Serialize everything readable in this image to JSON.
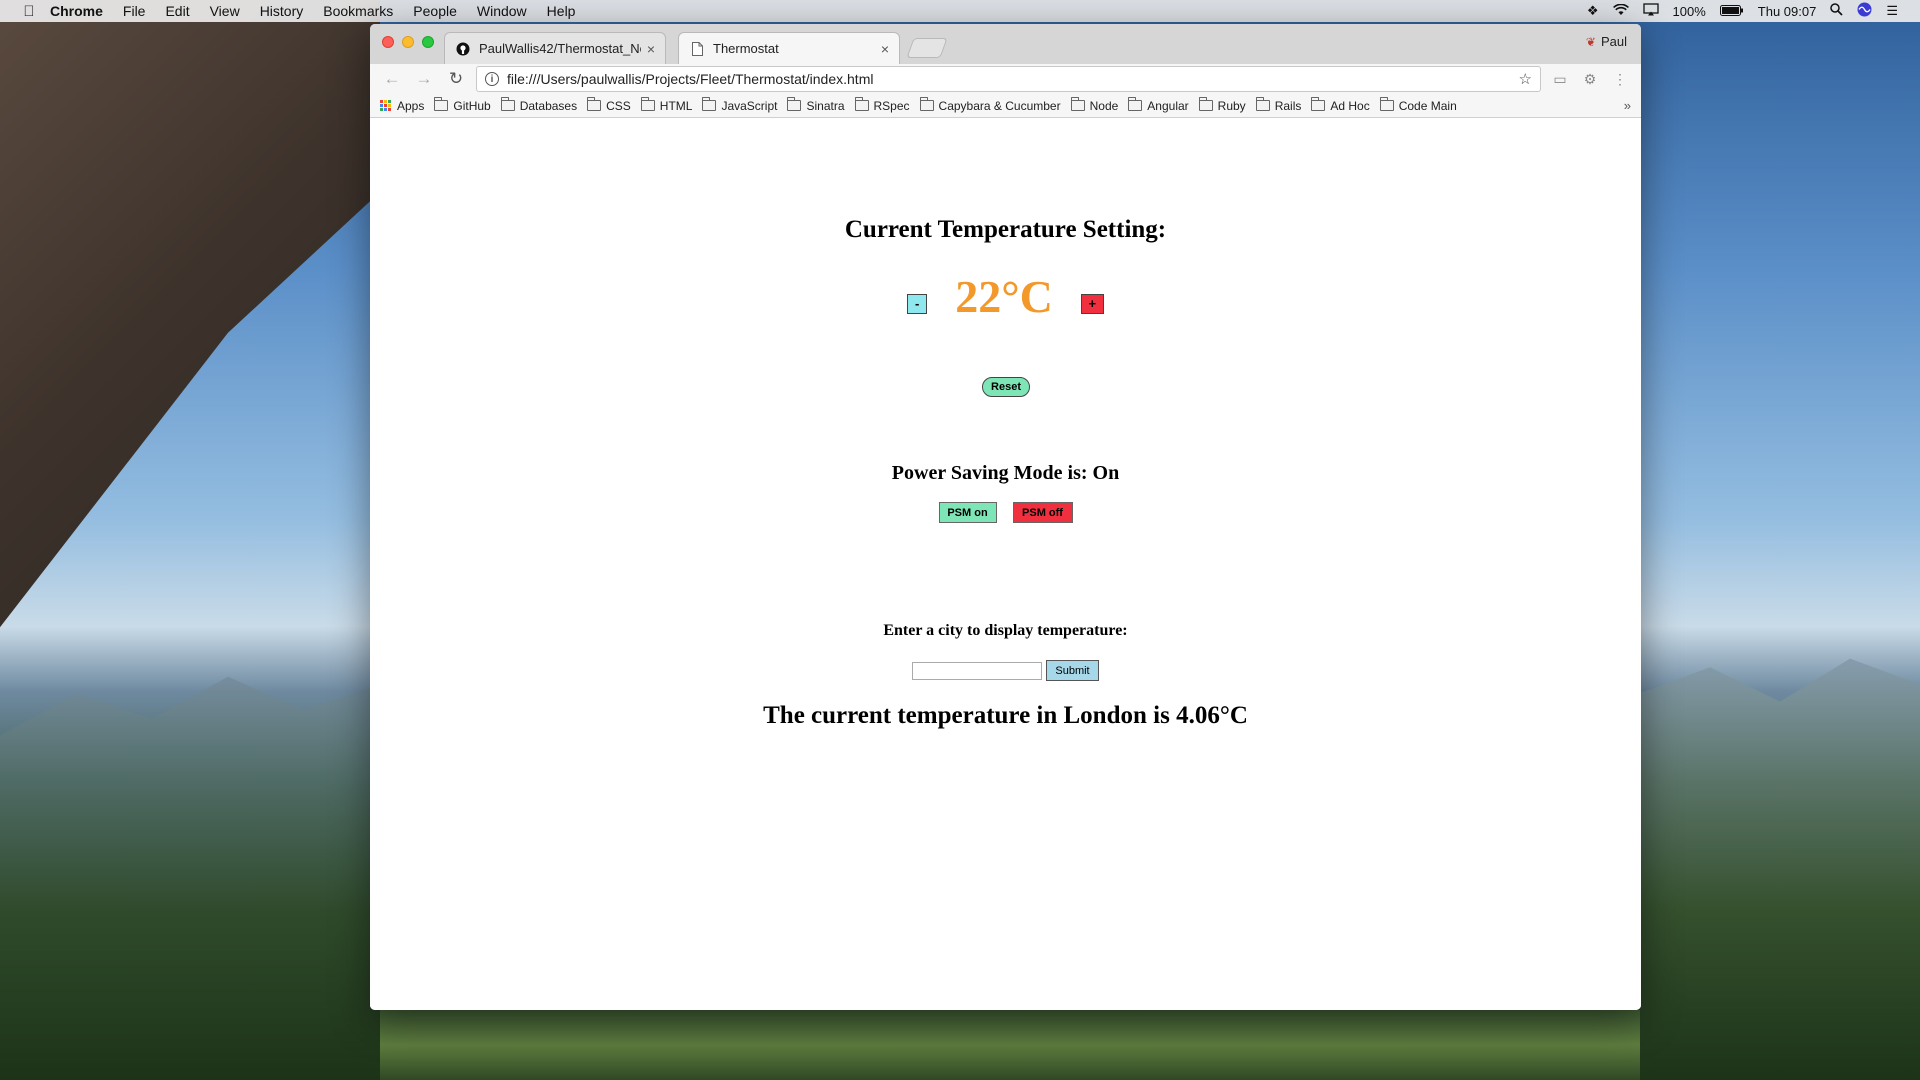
{
  "menubar": {
    "apple": "",
    "items": [
      "Chrome",
      "File",
      "Edit",
      "View",
      "History",
      "Bookmarks",
      "People",
      "Window",
      "Help"
    ],
    "battery": "100%",
    "clock": "Thu 09:07"
  },
  "browser": {
    "tabs": [
      {
        "title": "PaulWallis42/Thermostat_New",
        "close": "×"
      },
      {
        "title": "Thermostat",
        "close": "×"
      }
    ],
    "profile_name": "Paul",
    "url": "file:///Users/paulwallis/Projects/Fleet/Thermostat/index.html",
    "nav": {
      "back": "←",
      "forward": "→",
      "reload": "↻"
    },
    "star": "☆",
    "menu_dots": "⋮",
    "bookmarks": [
      "Apps",
      "GitHub",
      "Databases",
      "CSS",
      "HTML",
      "JavaScript",
      "Sinatra",
      "RSpec",
      "Capybara & Cucumber",
      "Node",
      "Angular",
      "Ruby",
      "Rails",
      "Ad Hoc",
      "Code Main"
    ],
    "bookmarks_more": "»",
    "colors": {
      "apps_grid": [
        "#ea4335",
        "#fbbc05",
        "#34a853",
        "#4285f4",
        "#ea4335",
        "#fbbc05",
        "#34a853",
        "#4285f4",
        "#ea4335"
      ]
    }
  },
  "page": {
    "heading": "Current Temperature Setting:",
    "minus_label": "-",
    "temperature": "22°C",
    "plus_label": "+",
    "reset_label": "Reset",
    "psm_status": "Power Saving Mode is: On",
    "psm_on_label": "PSM on",
    "psm_off_label": "PSM off",
    "city_prompt": "Enter a city to display temperature:",
    "city_value": "",
    "submit_label": "Submit",
    "weather_result": "The current temperature in London is 4.06°C",
    "colors": {
      "temperature": "#f3982a",
      "minus_btn": "#8fe8ee",
      "plus_btn": "#f0303e",
      "green_btn": "#7ee6b6",
      "submit_btn": "#a6d8ea"
    }
  }
}
